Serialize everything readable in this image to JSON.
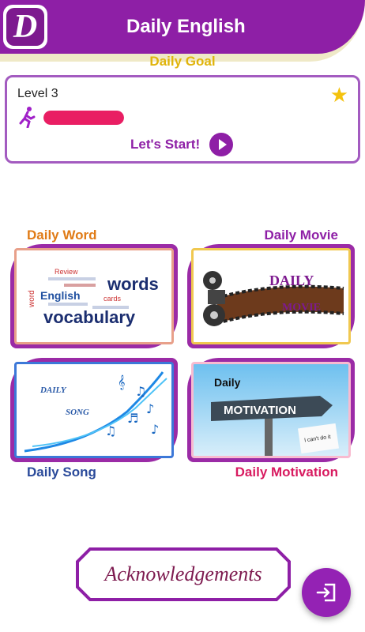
{
  "header": {
    "title": "Daily English",
    "logo_letter": "D"
  },
  "goal": {
    "label": "Daily Goal",
    "level": "Level 3",
    "progress": 1.0,
    "start_label": "Let's Start!"
  },
  "sections": {
    "word": {
      "label": "Daily Word",
      "color": "#e07b16"
    },
    "movie": {
      "label": "Daily Movie",
      "color": "#8e1fa6"
    },
    "song": {
      "label": "Daily Song",
      "color": "#2a4a9a"
    },
    "motivation": {
      "label": "Daily Motivation",
      "color": "#d81b60"
    }
  },
  "tiles": {
    "word": {
      "big1": "words",
      "big2": "vocabulary",
      "w1": "English",
      "w2": "Review",
      "w3": "cards",
      "w4": "word"
    },
    "movie": {
      "t1": "DAILY",
      "t2": "MOVIE"
    },
    "song": {
      "t1": "DAILY",
      "t2": "SONG"
    },
    "motivation": {
      "t1": "Daily",
      "t2": "MOTIVATION",
      "t3": "I can't do it"
    }
  },
  "footer": {
    "ack_label": "Acknowledgements"
  },
  "colors": {
    "primary": "#8e1fa6",
    "accent": "#e91e63",
    "gold": "#e0b40c"
  }
}
